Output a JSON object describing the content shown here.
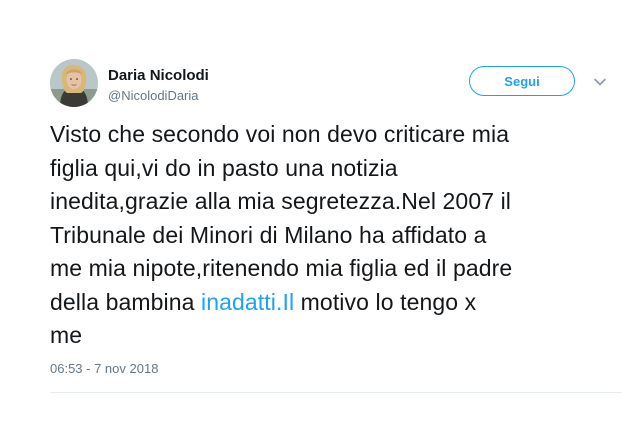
{
  "author": {
    "display_name": "Daria Nicolodi",
    "handle": "@NicolodiDaria",
    "avatar_icon": "profile-photo"
  },
  "actions": {
    "follow_label": "Segui",
    "more_icon": "chevron-down-icon"
  },
  "tweet": {
    "lines": [
      "Visto che secondo voi non devo criticare mia",
      "figlia qui,vi do in pasto una notizia",
      "inedita,grazie alla mia segretezza.Nel 2007 il",
      "Tribunale dei Minori di Milano ha affidato a",
      "me mia nipote,ritenendo mia figlia ed il padre"
    ],
    "line6_before": "della bambina ",
    "line6_link": "inadatti.Il",
    "line6_after": " motivo lo tengo x",
    "line7": "me",
    "timestamp": "06:53 - 7 nov 2018"
  },
  "colors": {
    "accent": "#1da1f2",
    "text": "#14171a",
    "secondary": "#657786",
    "divider": "#e6ecf0"
  }
}
